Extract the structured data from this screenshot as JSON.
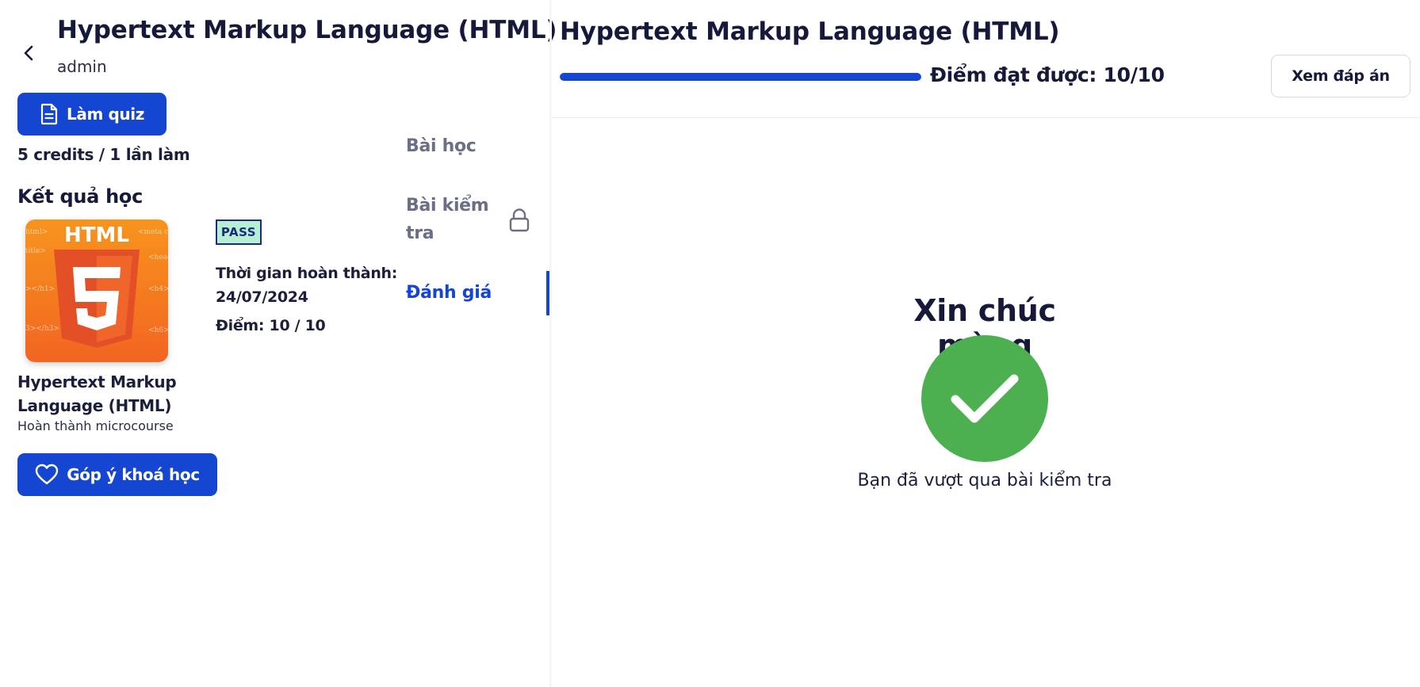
{
  "course": {
    "title": "Hypertext Markup Language (HTML)",
    "author": "admin"
  },
  "actions": {
    "quiz_label": "Làm quiz",
    "credits": "5 credits / 1 lần làm",
    "feedback_label": "Góp ý khoá học"
  },
  "results": {
    "section_title": "Kết quả học",
    "card_title": "Hypertext Markup Language (HTML)",
    "card_subtitle": "Hoàn thành microcourse",
    "thumbnail_text": "HTML",
    "thumbnail_snippets": [
      "html>",
      "title>",
      "></h1>",
      "3></h3>",
      "<meta ch",
      "<head",
      "<h4>",
      "<h6>"
    ],
    "badge": "PASS",
    "completed_at": "Thời gian hoàn thành: 24/07/2024",
    "score": "Điểm: 10 / 10"
  },
  "nav": {
    "items": [
      {
        "label": "Bài học",
        "state": "normal"
      },
      {
        "label": "Bài kiểm tra",
        "state": "locked"
      },
      {
        "label": "Đánh giá",
        "state": "active"
      }
    ]
  },
  "quiz": {
    "title": "Hypertext Markup Language (HTML)",
    "progress": 1.0,
    "score_label": "Điểm đạt được: 10/10",
    "view_answers_label": "Xem đáp án",
    "congrats": "Xin chúc mừng",
    "passed_message": "Bạn đã vượt qua bài kiểm tra"
  },
  "colors": {
    "primary": "#1446d2",
    "success": "#4caf50",
    "badge_bg": "#b5f0d5",
    "html_orange": "#e34f26"
  },
  "icons": {
    "back": "chevron-left-icon",
    "quiz": "document-icon",
    "feedback": "heart-icon",
    "lock": "lock-icon",
    "check": "checkmark-icon"
  }
}
